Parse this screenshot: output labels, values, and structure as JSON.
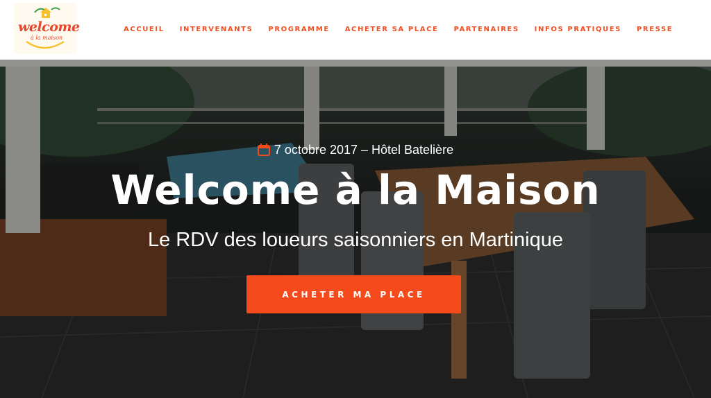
{
  "header": {
    "logo": {
      "text": "welcome",
      "subtext": "à la maison"
    },
    "nav": [
      {
        "label": "ACCUEIL"
      },
      {
        "label": "INTERVENANTS"
      },
      {
        "label": "PROGRAMME"
      },
      {
        "label": "ACHETER SA PLACE"
      },
      {
        "label": "PARTENAIRES"
      },
      {
        "label": "INFOS PRATIQUES"
      },
      {
        "label": "PRESSE"
      }
    ]
  },
  "hero": {
    "date": "7 octobre 2017 – Hôtel Batelière",
    "date_icon": "calendar-icon",
    "title": "Welcome à la Maison",
    "subtitle": "Le RDV des loueurs saisonniers en Martinique",
    "cta_label": "ACHETER MA PLACE"
  },
  "colors": {
    "accent": "#f44a1c",
    "nav_text": "#f04e23",
    "header_bg": "#ffffff"
  }
}
